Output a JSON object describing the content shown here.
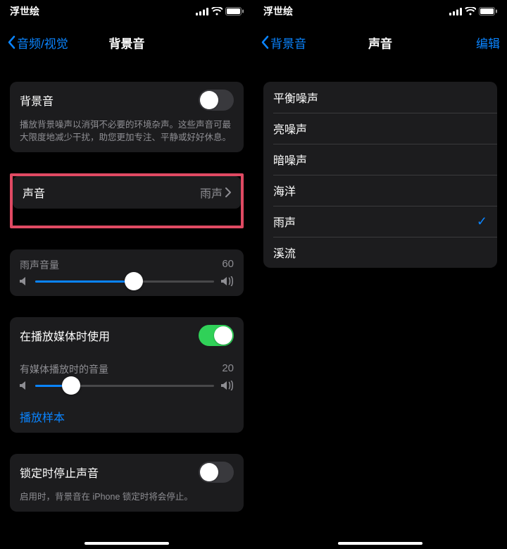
{
  "left": {
    "status_name": "浮世绘",
    "back_label": "音频/视觉",
    "title": "背景音",
    "bg_toggle_label": "背景音",
    "bg_toggle_on": false,
    "bg_desc": "播放背景噪声以消弭不必要的环境杂声。这些声音可最大限度地减少干扰，助您更加专注、平静或好好休息。",
    "sound_label": "声音",
    "sound_value": "雨声",
    "vol_label": "雨声音量",
    "vol_value": "60",
    "vol_percent": 55,
    "media_use_label": "在播放媒体时使用",
    "media_use_on": true,
    "media_vol_label": "有媒体播放时的音量",
    "media_vol_value": "20",
    "media_vol_percent": 20,
    "play_sample": "播放样本",
    "lock_label": "锁定时停止声音",
    "lock_on": false,
    "lock_desc": "启用时，背景音在 iPhone 锁定时将会停止。"
  },
  "right": {
    "status_name": "浮世绘",
    "back_label": "背景音",
    "title": "声音",
    "edit_label": "编辑",
    "options": [
      "平衡噪声",
      "亮噪声",
      "暗噪声",
      "海洋",
      "雨声",
      "溪流"
    ],
    "selected": "雨声"
  }
}
